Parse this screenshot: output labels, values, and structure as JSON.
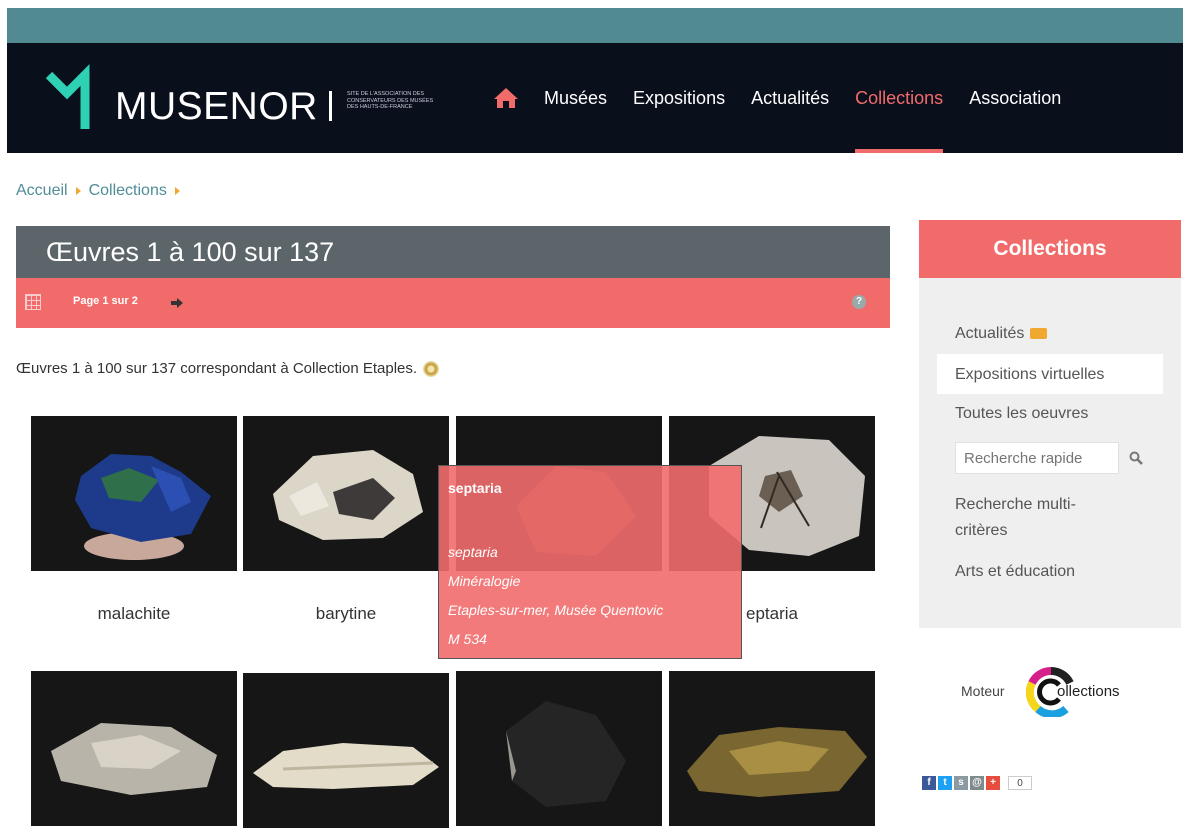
{
  "header": {
    "logo_text": "MUSENOR",
    "logo_subtitle": "SITE DE L'ASSOCIATION DES CONSERVATEURS DES MUSÉES DES HAUTS-DE-FRANCE",
    "nav": [
      {
        "label": "Musées"
      },
      {
        "label": "Expositions"
      },
      {
        "label": "Actualités"
      },
      {
        "label": "Collections",
        "active": true
      },
      {
        "label": "Association"
      }
    ],
    "accent_color": "#f26b6b",
    "band_color": "#528a91",
    "bg_color": "#0a0f1c"
  },
  "breadcrumb": [
    "Accueil",
    "Collections"
  ],
  "results": {
    "title": "Œuvres 1 à 100 sur 137",
    "page_label": "Page 1 sur 2",
    "summary": "Œuvres 1 à 100 sur 137 correspondant à Collection Etaples."
  },
  "items": [
    {
      "label": "malachite"
    },
    {
      "label": "barytine"
    },
    {
      "label": ""
    },
    {
      "label": "eptaria"
    },
    {
      "label": ""
    },
    {
      "label": ""
    },
    {
      "label": ""
    },
    {
      "label": ""
    }
  ],
  "tooltip": {
    "title": "septaria",
    "name": "septaria",
    "category": "Minéralogie",
    "museum": "Etaples-sur-mer, Musée Quentovic",
    "inventory": "M 534"
  },
  "sidebar": {
    "title": "Collections",
    "items": [
      "Actualités",
      "Expositions virtuelles",
      "Toutes les oeuvres",
      "Recherche multi-critères",
      "Arts et éducation"
    ],
    "search_placeholder": "Recherche rapide"
  },
  "moteur": {
    "word": "Moteur",
    "collections_rest": "ollections"
  },
  "share": {
    "count": "0"
  }
}
